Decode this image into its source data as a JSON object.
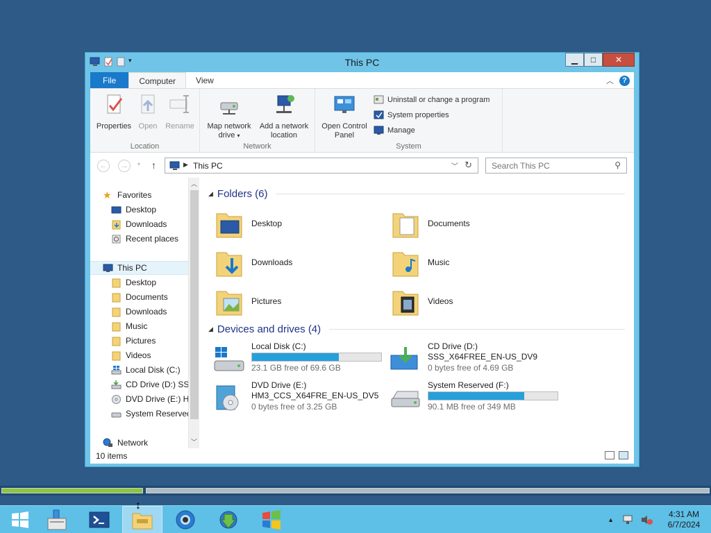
{
  "window": {
    "title": "This PC"
  },
  "ribbon": {
    "tabs": [
      {
        "label": "File"
      },
      {
        "label": "Computer"
      },
      {
        "label": "View"
      }
    ],
    "groups": {
      "location": {
        "label": "Location",
        "properties": "Properties",
        "open": "Open",
        "rename": "Rename"
      },
      "network": {
        "label": "Network",
        "map_drive_line1": "Map network",
        "map_drive_line2": "drive",
        "add_location_line1": "Add a network",
        "add_location_line2": "location"
      },
      "system": {
        "label": "System",
        "open_cp_line1": "Open Control",
        "open_cp_line2": "Panel",
        "uninstall": "Uninstall or change a program",
        "system_properties": "System properties",
        "manage": "Manage"
      }
    }
  },
  "address": {
    "path": "This PC",
    "search_placeholder": "Search This PC"
  },
  "nav": {
    "favorites": "Favorites",
    "fav_items": [
      "Desktop",
      "Downloads",
      "Recent places"
    ],
    "this_pc": "This PC",
    "pc_items": [
      "Desktop",
      "Documents",
      "Downloads",
      "Music",
      "Pictures",
      "Videos",
      "Local Disk (C:)",
      "CD Drive (D:) SSS",
      "DVD Drive (E:) HM",
      "System Reserved"
    ],
    "network": "Network"
  },
  "content": {
    "folders_header": "Folders (6)",
    "folders": [
      "Desktop",
      "Documents",
      "Downloads",
      "Music",
      "Pictures",
      "Videos"
    ],
    "drives_header": "Devices and drives (4)",
    "drives": [
      {
        "name": "Local Disk (C:)",
        "label": "",
        "free": "23.1 GB free of 69.6 GB",
        "used_fraction": 0.67
      },
      {
        "name": "CD Drive (D:)",
        "label": "SSS_X64FREE_EN-US_DV9",
        "free": "0 bytes free of 4.69 GB"
      },
      {
        "name": "DVD Drive (E:)",
        "label": "HM3_CCS_X64FRE_EN-US_DV5",
        "free": "0 bytes free of 3.25 GB"
      },
      {
        "name": "System Reserved (F:)",
        "label": "",
        "free": "90.1 MB free of 349 MB",
        "used_fraction": 0.74
      }
    ]
  },
  "status": {
    "items": "10 items"
  },
  "tray": {
    "time": "4:31 AM",
    "date": "6/7/2024"
  },
  "colors": {
    "accent": "#1979ca",
    "window_frame": "#6fc4e8",
    "desktop": "#2d5a86",
    "taskbar": "#5ebfe7",
    "drive_bar": "#26a0da"
  }
}
